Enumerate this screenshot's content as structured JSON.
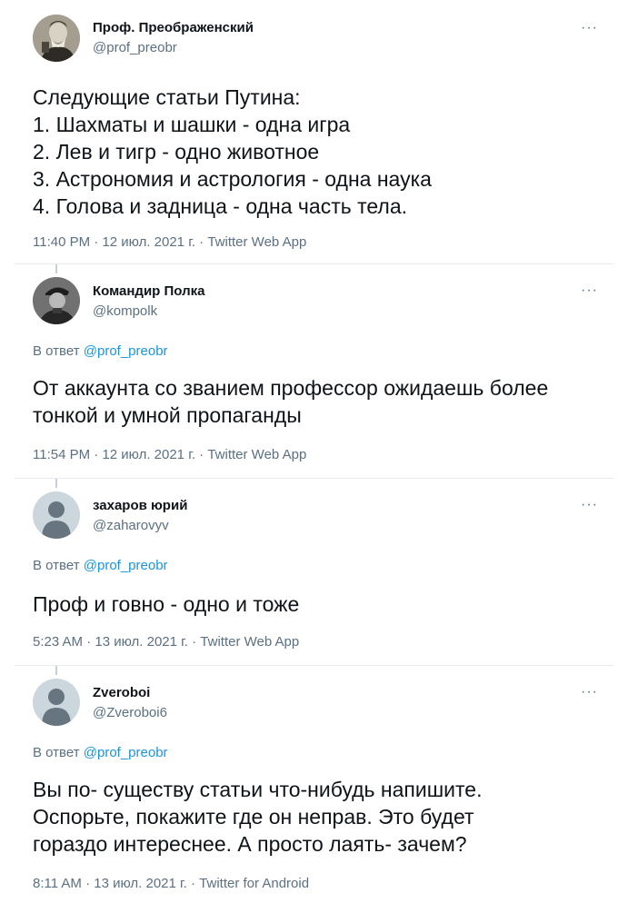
{
  "tweets": [
    {
      "name": "Проф. Преображенский",
      "handle": "@prof_preobr",
      "more": "···",
      "avatar_icon": "profile-photo-old-man",
      "lines": [
        "Следующие статьи Путина:",
        "1. Шахматы и шашки - одна игра",
        "2. Лев и тигр - одно животное",
        "3. Астрономия и астрология - одна наука",
        "4. Голова и задница - одна часть тела."
      ],
      "time": "11:40 PM · 12 июл. 2021 г. · ",
      "app": "Twitter Web App"
    },
    {
      "name": "Командир Полка",
      "handle": "@kompolk",
      "more": "···",
      "avatar_icon": "profile-photo-officer",
      "reply_prefix": "В ответ ",
      "reply_to": "@prof_preobr",
      "lines": [
        "От аккаунта со званием профессор ожидаешь более",
        "тонкой и умной пропаганды"
      ],
      "time": "11:54 PM · 12 июл. 2021 г. · ",
      "app": "Twitter Web App"
    },
    {
      "name": "захаров юрий",
      "handle": "@zaharovyv",
      "more": "···",
      "avatar_icon": "default-avatar-icon",
      "reply_prefix": "В ответ ",
      "reply_to": "@prof_preobr",
      "lines": [
        "Проф и говно - одно и тоже"
      ],
      "time": "5:23 AM · 13 июл. 2021 г. · ",
      "app": "Twitter Web App"
    },
    {
      "name": "Zveroboi",
      "handle": "@Zveroboi6",
      "more": "···",
      "avatar_icon": "default-avatar-icon",
      "reply_prefix": "В ответ ",
      "reply_to": "@prof_preobr",
      "lines": [
        "Вы по- существу статьи что-нибудь напишите.",
        "Оспорьте, покажите где он неправ. Это будет",
        "гораздо интереснее. А просто лаять- зачем?"
      ],
      "time": "8:11 AM · 13 июл. 2021 г. · ",
      "app": "Twitter for Android"
    }
  ]
}
